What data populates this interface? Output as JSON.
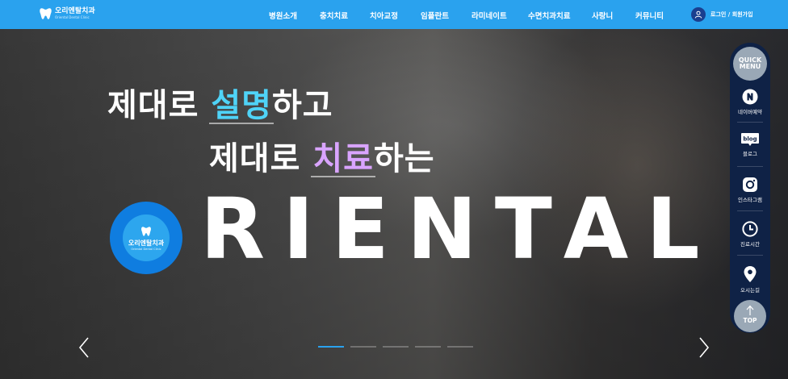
{
  "header": {
    "logo_ko": "오리엔탈치과",
    "logo_en": "Oriental Dental Clinic",
    "nav": [
      "병원소개",
      "충치치료",
      "치아교정",
      "임플란트",
      "라미네이트",
      "수면치과치료",
      "사랑니",
      "커뮤니티"
    ],
    "login": "로그인 / 회원가입"
  },
  "hero": {
    "line1_before": "제대로 ",
    "line1_highlight": "설명",
    "line1_after": "하고",
    "line2_before": "제대로 ",
    "line2_highlight": "치료",
    "line2_after": "하는",
    "brand_ko": "오리엔탈치과",
    "brand_en": "Oriental Dental Clinic",
    "big_word": "RIENTAL",
    "slide_count": 5,
    "active_slide": 1
  },
  "quick_menu": {
    "title": "QUICK MENU",
    "items": [
      {
        "label": "네이버예약",
        "icon": "naver-icon"
      },
      {
        "label": "블로그",
        "icon": "blog-icon"
      },
      {
        "label": "인스타그램",
        "icon": "instagram-icon"
      },
      {
        "label": "진료시간",
        "icon": "clock-icon"
      },
      {
        "label": "오시는길",
        "icon": "location-pin-icon"
      }
    ],
    "top_label": "TOP"
  },
  "colors": {
    "header_bg": "#2aa2ee",
    "quick_bg": "#0f2246",
    "accent_blue": "#4fd3f7",
    "accent_purple": "#d9a4ff"
  }
}
